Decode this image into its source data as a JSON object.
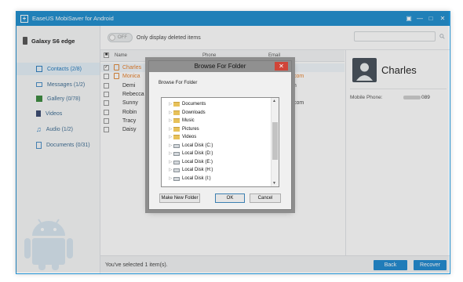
{
  "app": {
    "title": "EaseUS MobiSaver for Android",
    "accent_color": "#1f8fd0"
  },
  "window_controls": [
    {
      "name": "window-menu-icon",
      "glyph": "▣"
    },
    {
      "name": "minimize-icon",
      "glyph": "—"
    },
    {
      "name": "maximize-icon",
      "glyph": "□"
    },
    {
      "name": "close-icon",
      "glyph": "✕"
    }
  ],
  "sidebar": {
    "device": "Galaxy S6 edge",
    "items": [
      {
        "label": "Contacts (2/8)",
        "icon": "contacts-icon",
        "active": true
      },
      {
        "label": "Messages (1/2)",
        "icon": "messages-icon",
        "active": false
      },
      {
        "label": "Gallery (0/78)",
        "icon": "gallery-icon",
        "active": false
      },
      {
        "label": "Videos",
        "icon": "videos-icon",
        "active": false
      },
      {
        "label": "Audio (1/2)",
        "icon": "audio-icon",
        "active": false
      },
      {
        "label": "Documents (0/31)",
        "icon": "documents-icon",
        "active": false
      }
    ]
  },
  "topbar": {
    "toggle_text": "OFF",
    "toggle_label": "Only display deleted items",
    "search_value": ""
  },
  "table": {
    "columns": [
      "Name",
      "Phone",
      "Email"
    ],
    "rows": [
      {
        "name": "Charles",
        "deleted": true,
        "checked": true,
        "email": ""
      },
      {
        "name": "Monica",
        "deleted": true,
        "checked": false,
        "email": ".com"
      },
      {
        "name": "Demi",
        "deleted": false,
        "checked": false,
        "email": "m"
      },
      {
        "name": "Rebecca",
        "deleted": false,
        "checked": false,
        "email": ""
      },
      {
        "name": "Sunny",
        "deleted": false,
        "checked": false,
        "email": ".com"
      },
      {
        "name": "Robin",
        "deleted": false,
        "checked": false,
        "email": ""
      },
      {
        "name": "Tracy",
        "deleted": false,
        "checked": false,
        "email": ""
      },
      {
        "name": "Daisy",
        "deleted": false,
        "checked": false,
        "email": ""
      }
    ]
  },
  "detail": {
    "name": "Charles",
    "phone_label": "Mobile Phone:",
    "phone_visible_suffix": "089"
  },
  "footer": {
    "status": "You've selected 1 item(s).",
    "back_label": "Back",
    "recover_label": "Recover"
  },
  "dialog": {
    "title": "Browse For Folder",
    "subtitle": "Browse For Folder",
    "close_glyph": "✕",
    "folders": [
      {
        "label": "Documents",
        "icon": "folder-icon"
      },
      {
        "label": "Downloads",
        "icon": "folder-icon"
      },
      {
        "label": "Music",
        "icon": "folder-icon"
      },
      {
        "label": "Pictures",
        "icon": "folder-icon"
      },
      {
        "label": "Videos",
        "icon": "folder-icon"
      },
      {
        "label": "Local Disk (C:)",
        "icon": "drive-icon"
      },
      {
        "label": "Local Disk (D:)",
        "icon": "drive-icon"
      },
      {
        "label": "Local Disk (E:)",
        "icon": "drive-icon"
      },
      {
        "label": "Local Disk (H:)",
        "icon": "drive-icon"
      },
      {
        "label": "Local Disk (I:)",
        "icon": "drive-icon"
      }
    ],
    "new_folder_label": "Make New Folder",
    "ok_label": "OK",
    "cancel_label": "Cancel"
  }
}
